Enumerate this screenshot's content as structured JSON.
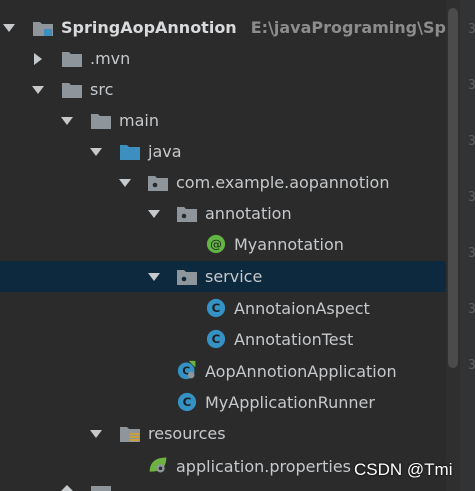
{
  "project": {
    "name": "SpringAopAnnotion",
    "path": "E:\\javaPrograming\\SpringA"
  },
  "tree": {
    "mvn": ".mvn",
    "src": "src",
    "main": "main",
    "java": "java",
    "package": "com.example.aopannotion",
    "annotation_pkg": "annotation",
    "myannotation": "Myannotation",
    "service_pkg": "service",
    "aspect": "AnnotaionAspect",
    "test": "AnnotationTest",
    "app": "AopAnnotionApplication",
    "runner": "MyApplicationRunner",
    "resources": "resources",
    "properties": "application.properties"
  },
  "gutter": {
    "digit": "3"
  },
  "watermark": "CSDN @Tmi",
  "colors": {
    "background": "#2b2b2b",
    "selection": "#0d293e",
    "folder": "#8e969c",
    "source_folder": "#3d8fbf",
    "class_icon": "#3592c4",
    "annotation_icon": "#62b543",
    "spring_green": "#6db33f"
  }
}
